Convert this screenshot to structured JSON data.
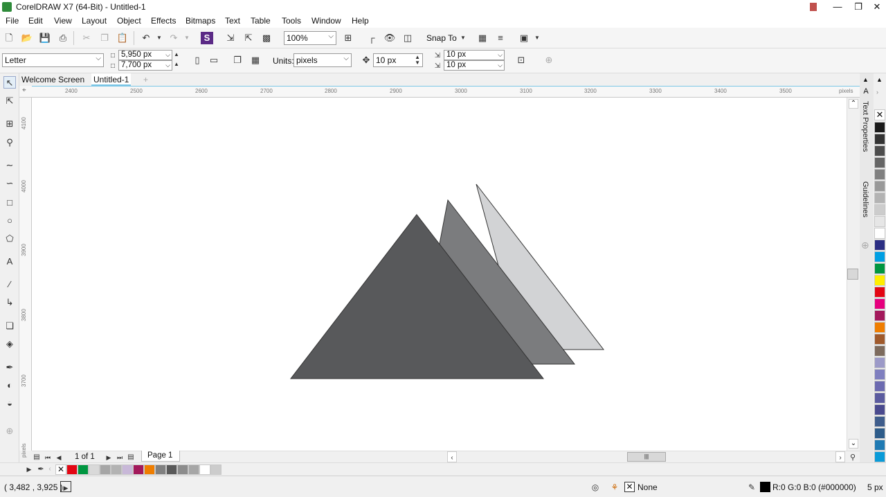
{
  "window": {
    "title": "CorelDRAW X7 (64-Bit) - Untitled-1",
    "controls": [
      "minimize",
      "restore",
      "close"
    ]
  },
  "menu": [
    "File",
    "Edit",
    "View",
    "Layout",
    "Object",
    "Effects",
    "Bitmaps",
    "Text",
    "Table",
    "Tools",
    "Window",
    "Help"
  ],
  "standard_toolbar": {
    "zoom_value": "100%",
    "snap_to_label": "Snap To"
  },
  "property_bar": {
    "page_size": "Letter",
    "width": "5,950 px",
    "height": "7,700 px",
    "units_label": "Units:",
    "units_value": "pixels",
    "nudge": "10 px",
    "dup_x": "10 px",
    "dup_y": "10 px"
  },
  "doc_tabs": [
    {
      "label": "Welcome Screen",
      "active": false
    },
    {
      "label": "Untitled-1",
      "active": true
    }
  ],
  "rulers": {
    "horizontal_labels": [
      "2400",
      "2500",
      "2600",
      "2700",
      "2800",
      "2900",
      "3000",
      "3100",
      "3200",
      "3300",
      "3400",
      "3500"
    ],
    "horizontal_unit": "pixels",
    "vertical_labels": [
      "4100",
      "4000",
      "3900",
      "3800",
      "3700"
    ],
    "vertical_unit": "pixels"
  },
  "canvas": {
    "shapes": [
      {
        "name": "back-triangle",
        "fill": "#d2d3d5",
        "stroke": "#333333"
      },
      {
        "name": "middle-triangle",
        "fill": "#7b7c7e",
        "stroke": "#333333"
      },
      {
        "name": "front-triangle",
        "fill": "#58595b",
        "stroke": "#333333"
      }
    ]
  },
  "page_nav": {
    "page_count_text": "1 of 1",
    "page_tab": "Page 1"
  },
  "dockers": [
    "Text Properties",
    "Guidelines"
  ],
  "color_palette": [
    "#1a1a1a",
    "#333333",
    "#4d4d4d",
    "#666666",
    "#808080",
    "#999999",
    "#b3b3b3",
    "#cccccc",
    "#e6e6e6",
    "#ffffff",
    "#2b2e83",
    "#009fe3",
    "#009640",
    "#ffed00",
    "#e30613",
    "#e6007e",
    "#a3195b",
    "#ef7d00",
    "#a05a2c",
    "#7d6b5d",
    "#9c9ac8",
    "#7f7fbf",
    "#6c6ab0",
    "#5b5b9f",
    "#4a4a8e",
    "#3f5d8c",
    "#2e5c8a",
    "#1f7ab3",
    "#0a9bd8",
    "#00a0e0"
  ],
  "document_palette": [
    "#ffffff",
    "#e30613",
    "#009640",
    "#d9d9d9",
    "#a6a6a6",
    "#b3b3b3",
    "#c8b8d8",
    "#a3195b",
    "#ef7d00",
    "#808080",
    "#595959",
    "#8c8c8c",
    "#a6a6a6",
    "#ffffff",
    "#cccccc"
  ],
  "status": {
    "coordinates": "( 3,482 , 3,925 )",
    "fill_label": "None",
    "outline_label": "R:0 G:0 B:0 (#000000)",
    "outline_width": "5 px"
  }
}
